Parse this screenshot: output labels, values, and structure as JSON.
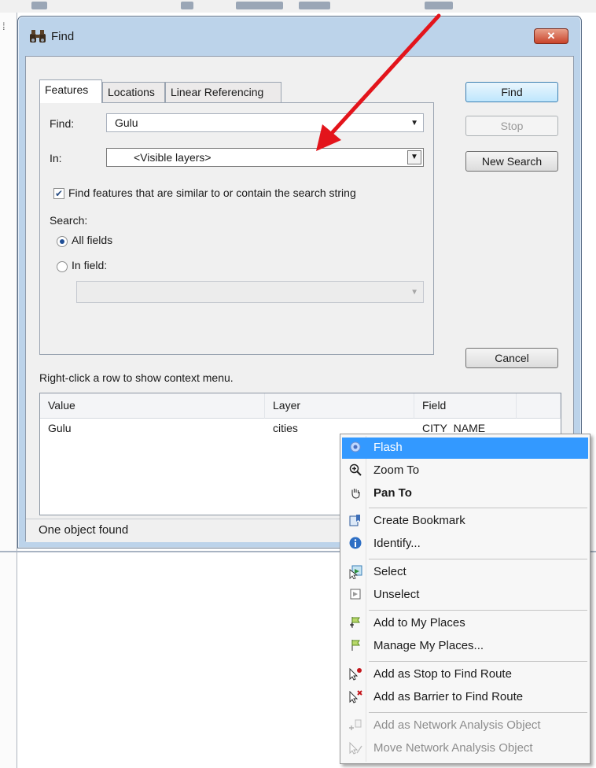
{
  "window": {
    "title": "Find",
    "title_icon": "binoculars-icon",
    "close_label": "✕"
  },
  "tabs": [
    {
      "label": "Features",
      "selected": true
    },
    {
      "label": "Locations",
      "selected": false
    },
    {
      "label": "Linear Referencing",
      "selected": false
    }
  ],
  "form": {
    "find_label": "Find:",
    "find_value": "Gulu",
    "in_label": "In:",
    "in_value": "<Visible layers>",
    "similar_checkbox_label": "Find features that are similar to or contain the search string",
    "similar_checked": true,
    "search_label": "Search:",
    "all_fields_label": "All fields",
    "all_fields_selected": true,
    "in_field_label": "In field:",
    "in_field_selected": false,
    "field_value": ""
  },
  "buttons": {
    "find": "Find",
    "stop": "Stop",
    "new_search": "New Search",
    "cancel": "Cancel"
  },
  "results": {
    "hint": "Right-click a row to show context menu.",
    "columns": [
      "Value",
      "Layer",
      "Field"
    ],
    "rows": [
      {
        "value": "Gulu",
        "layer": "cities",
        "field": "CITY_NAME"
      }
    ]
  },
  "status": {
    "text": "One object found"
  },
  "context_menu": {
    "items": [
      {
        "label": "Flash",
        "icon": "flash-icon",
        "state": "highlighted"
      },
      {
        "label": "Zoom To",
        "icon": "zoom-in-icon",
        "state": "normal"
      },
      {
        "label": "Pan To",
        "icon": "pan-hand-icon",
        "state": "bold"
      },
      {
        "label": "Create Bookmark",
        "icon": "bookmark-icon",
        "state": "normal"
      },
      {
        "label": "Identify...",
        "icon": "info-icon",
        "state": "normal"
      },
      {
        "label": "Select",
        "icon": "select-features-icon",
        "state": "normal"
      },
      {
        "label": "Unselect",
        "icon": "unselect-icon",
        "state": "normal"
      },
      {
        "label": "Add to My Places",
        "icon": "add-place-flag-icon",
        "state": "normal"
      },
      {
        "label": "Manage My Places...",
        "icon": "place-flag-icon",
        "state": "normal"
      },
      {
        "label": "Add as Stop to Find Route",
        "icon": "route-stop-icon",
        "state": "normal"
      },
      {
        "label": "Add as Barrier to Find Route",
        "icon": "route-barrier-icon",
        "state": "normal"
      },
      {
        "label": "Add as Network Analysis Object",
        "icon": "network-add-icon",
        "state": "disabled"
      },
      {
        "label": "Move Network Analysis Object",
        "icon": "network-move-icon",
        "state": "disabled"
      }
    ]
  },
  "colors": {
    "highlight": "#3399ff",
    "window_frame": "#bcd3ea",
    "annotation_arrow": "#e3141b"
  }
}
